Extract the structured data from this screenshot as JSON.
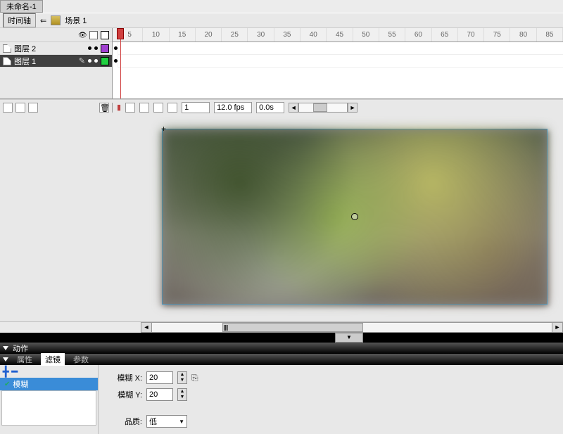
{
  "title_tab": "未命名-1",
  "toolbar": {
    "timeline_btn": "时间轴",
    "back": "⇐",
    "scene": "场景 1"
  },
  "layers": [
    {
      "name": "图层 2",
      "color": "purple"
    },
    {
      "name": "图层 1",
      "color": "green"
    }
  ],
  "ruler": [
    "5",
    "10",
    "15",
    "20",
    "25",
    "30",
    "35",
    "40",
    "45",
    "50",
    "55",
    "60",
    "65",
    "70",
    "75",
    "80",
    "85"
  ],
  "timeline_status": {
    "frame": "1",
    "fps": "12.0 fps",
    "time": "0.0s"
  },
  "actions_panel": {
    "label": "动作"
  },
  "prop_panel": {
    "tabs": {
      "properties": "属性",
      "filters": "滤镜",
      "params": "参数"
    },
    "filter_item": "模糊",
    "blur_x_label": "模糊 X:",
    "blur_x": "20",
    "blur_y_label": "模糊 Y:",
    "blur_y": "20",
    "quality_label": "品质:",
    "quality_value": "低"
  }
}
